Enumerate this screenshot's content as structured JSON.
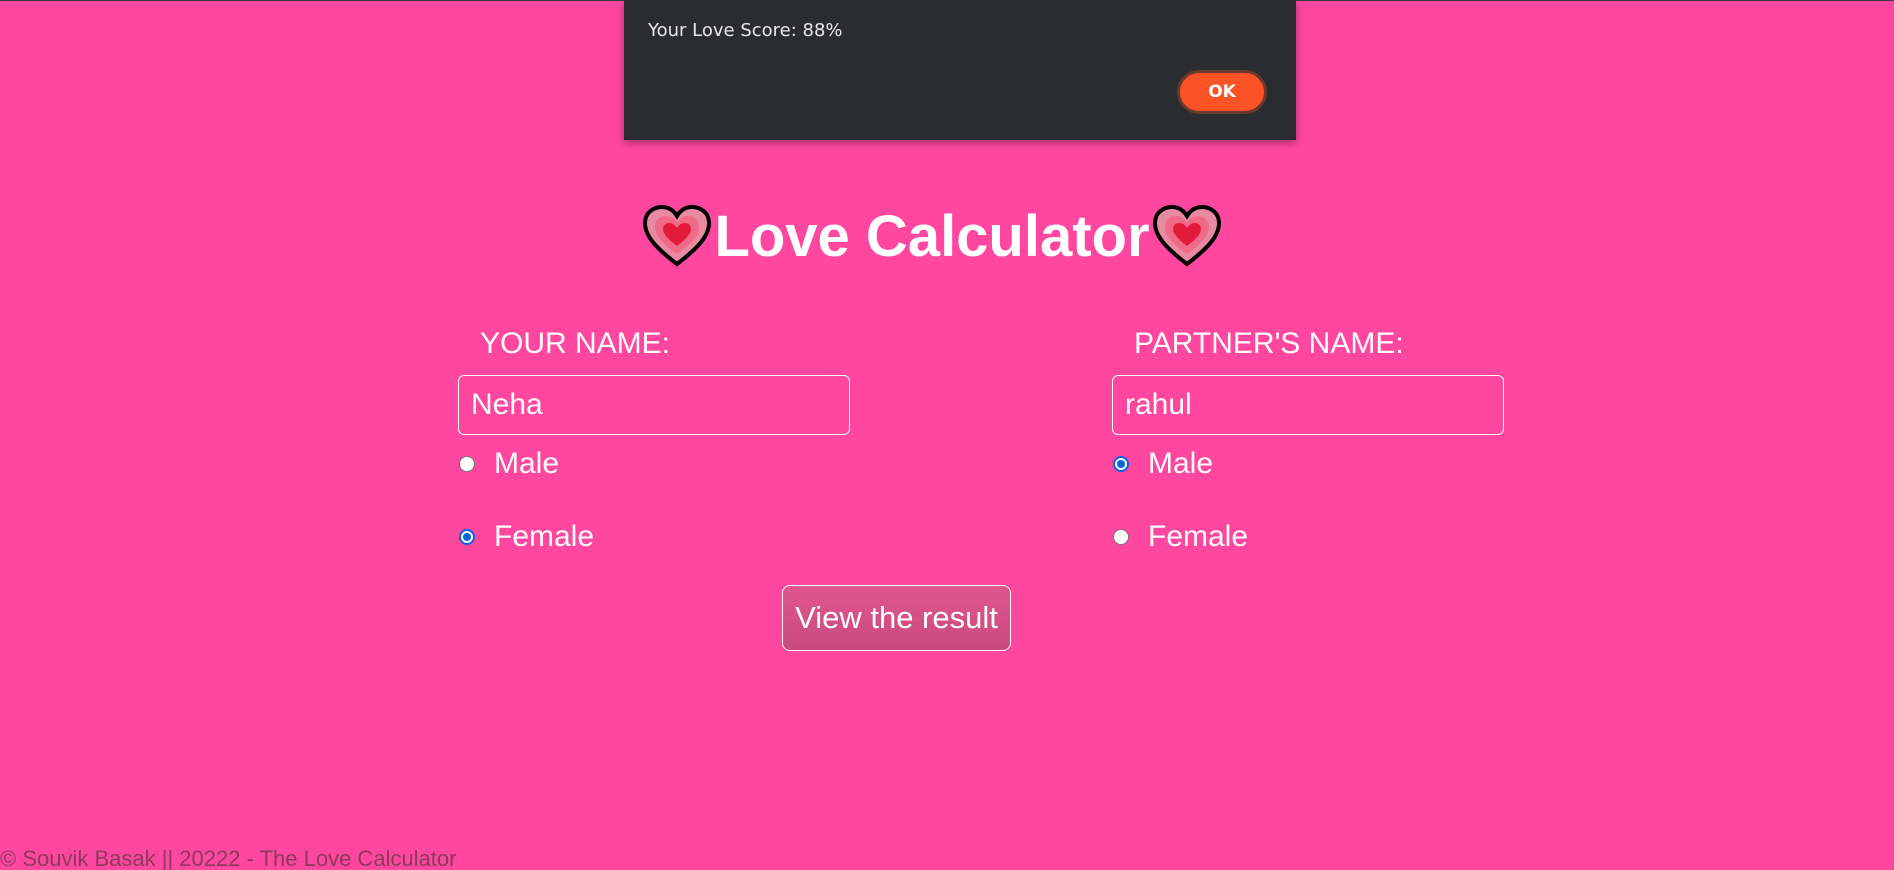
{
  "alert": {
    "message": "Your Love Score: 88%",
    "ok_label": "OK"
  },
  "header": {
    "title": "Love Calculator",
    "left_icon": "growing-heart-icon",
    "right_icon": "growing-heart-icon"
  },
  "your": {
    "label": "YOUR NAME:",
    "name_value": "Neha",
    "gender_options": [
      "Male",
      "Female"
    ],
    "selected_gender": "Female"
  },
  "partner": {
    "label": "PARTNER'S NAME:",
    "name_value": "rahul",
    "gender_options": [
      "Male",
      "Female"
    ],
    "selected_gender": "Male"
  },
  "submit": {
    "label": "View the result"
  },
  "footer": {
    "text": "© Souvik Basak || 20222 - The Love Calculator"
  },
  "colors": {
    "background": "#ff479f",
    "dialog": "#2b2c2f",
    "ok_button": "#fb5326",
    "radio_checked": "#0a64d8"
  }
}
